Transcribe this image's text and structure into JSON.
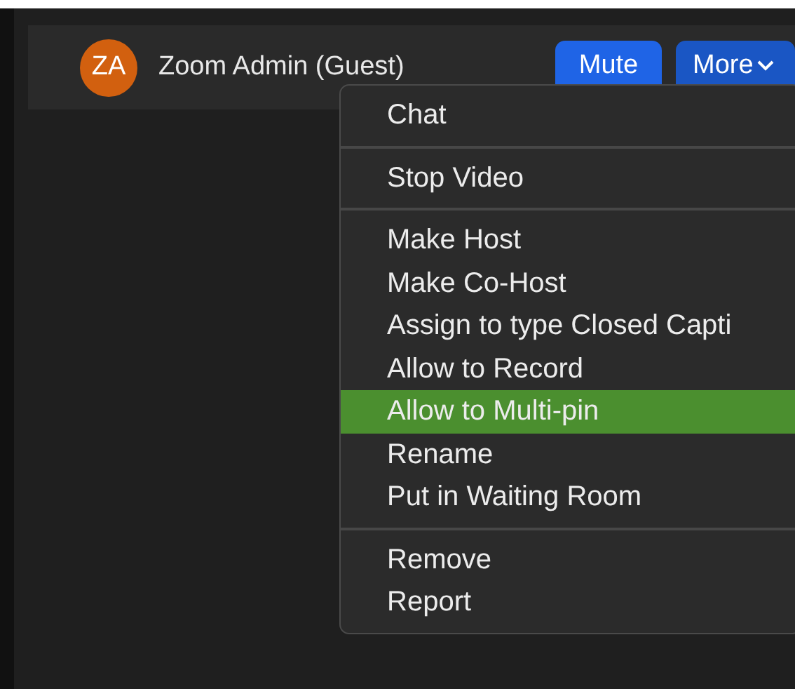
{
  "participant": {
    "initials": "ZA",
    "name": "Zoom Admin (Guest)"
  },
  "buttons": [
    {
      "label": "Mute",
      "kind": "plain"
    },
    {
      "label": "More",
      "kind": "dropdown"
    }
  ],
  "menu": {
    "sections": [
      {
        "items": [
          {
            "label": "Chat",
            "selected": false
          }
        ]
      },
      {
        "items": [
          {
            "label": "Stop Video",
            "selected": false
          }
        ]
      },
      {
        "items": [
          {
            "label": "Make Host",
            "selected": false
          },
          {
            "label": "Make Co-Host",
            "selected": false
          },
          {
            "label": "Assign to type Closed Capti",
            "selected": false
          },
          {
            "label": "Allow to Record",
            "selected": false
          },
          {
            "label": "Allow to Multi-pin",
            "selected": true
          },
          {
            "label": "Rename",
            "selected": false
          },
          {
            "label": "Put in Waiting Room",
            "selected": false
          }
        ]
      },
      {
        "items": [
          {
            "label": "Remove",
            "selected": false
          },
          {
            "label": "Report",
            "selected": false
          }
        ]
      }
    ]
  }
}
